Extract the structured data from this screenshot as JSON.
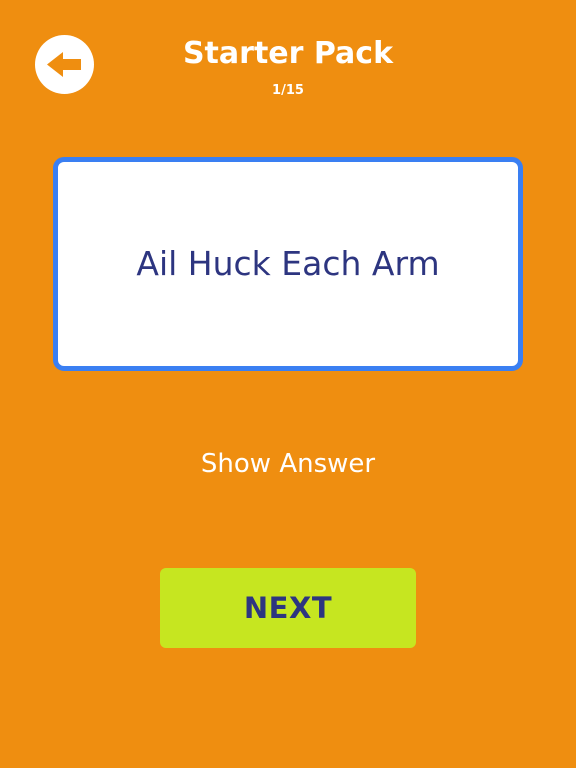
{
  "header": {
    "back_icon": "left-arrow-icon",
    "title": "Starter Pack",
    "progress": "1/15"
  },
  "card": {
    "text": "Ail Huck Each Arm"
  },
  "actions": {
    "show_answer": "Show Answer",
    "next": "NEXT"
  },
  "colors": {
    "background": "#ef8e10",
    "card_border": "#3a7ff2",
    "text_dark": "#2d3580",
    "next_button": "#c6e620"
  }
}
